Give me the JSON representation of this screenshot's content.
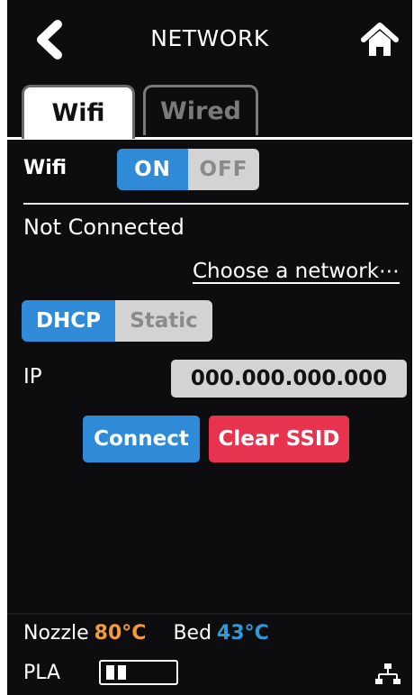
{
  "header": {
    "title": "NETWORK",
    "back_icon": "chevron-left-icon",
    "home_icon": "home-icon"
  },
  "tabs": [
    {
      "label": "Wifi",
      "active": true
    },
    {
      "label": "Wired",
      "active": false
    }
  ],
  "wifi": {
    "label": "Wifi",
    "toggle": {
      "on_label": "ON",
      "off_label": "OFF",
      "state": "ON"
    },
    "status": "Not Connected",
    "choose_network": "Choose a network⋯",
    "mode": {
      "dhcp_label": "DHCP",
      "static_label": "Static",
      "selected": "DHCP"
    },
    "ip_label": "IP",
    "ip_value": "000.000.000.000",
    "connect_label": "Connect",
    "clear_label": "Clear SSID"
  },
  "footer": {
    "nozzle_label": "Nozzle",
    "nozzle_temp": "80°C",
    "bed_label": "Bed",
    "bed_temp": "43°C",
    "material": "PLA",
    "network_icon": "wired-network-icon"
  },
  "colors": {
    "background": "#0d0d0f",
    "accent_blue": "#2f8ad8",
    "danger_red": "#e8334e",
    "nozzle_orange": "#f39a3a",
    "bed_blue": "#2f9ad8",
    "inactive_gray": "#d3d3d3"
  }
}
